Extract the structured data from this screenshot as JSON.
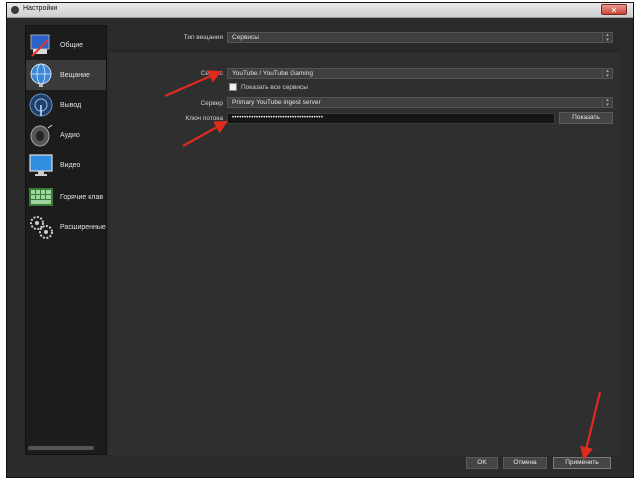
{
  "window": {
    "title": "Настройки",
    "close_glyph": "✕"
  },
  "sidebar": {
    "items": [
      {
        "label": "Общие",
        "icon": "general-settings-icon"
      },
      {
        "label": "Вещание",
        "icon": "broadcast-globe-icon"
      },
      {
        "label": "Вывод",
        "icon": "output-signal-icon"
      },
      {
        "label": "Аудио",
        "icon": "speaker-icon"
      },
      {
        "label": "Видео",
        "icon": "monitor-icon"
      },
      {
        "label": "Горячие клав",
        "icon": "keyboard-icon"
      },
      {
        "label": "Расширенные",
        "icon": "gears-icon"
      }
    ],
    "selected_index": 1
  },
  "stream": {
    "type_label": "Тип вещания",
    "type_value": "Сервисы",
    "service_label": "Сервис",
    "service_value": "YouTube / YouTube Gaming",
    "show_all_label": "Показать все сервисы",
    "server_label": "Сервер",
    "server_value": "Primary YouTube ingest server",
    "key_label": "Ключ потока",
    "key_value": "••••••••••••••••••••••••••••••••••••••",
    "show_button": "Показать"
  },
  "footer": {
    "ok": "OK",
    "cancel": "Отмена",
    "apply": "Применить"
  },
  "colors": {
    "annotation_arrow": "#e02a1e",
    "background": "#2b2b2b"
  }
}
